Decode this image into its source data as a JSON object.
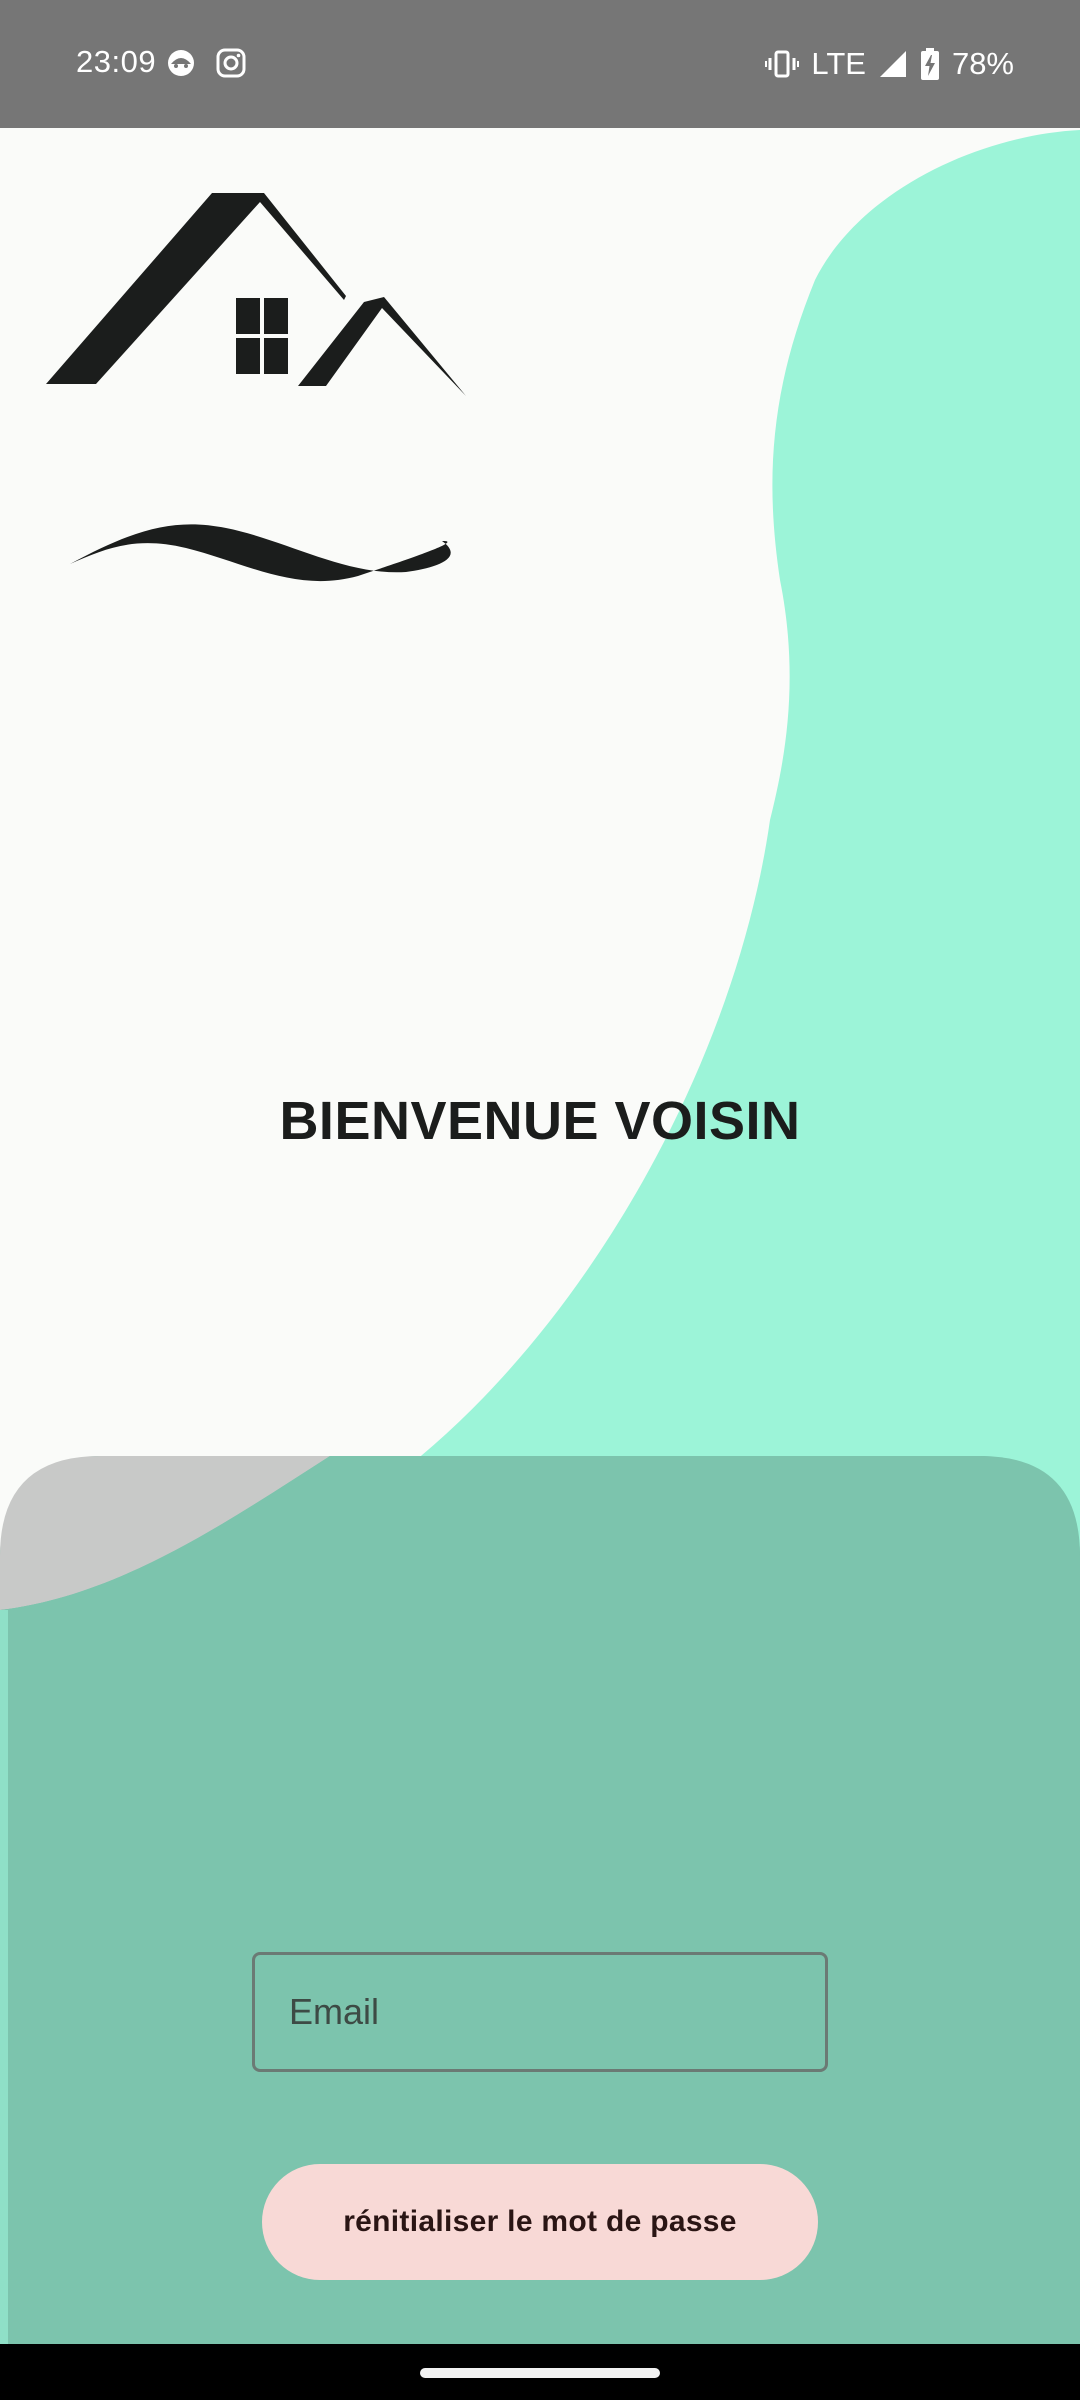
{
  "status_bar": {
    "time": "23:09",
    "network": "LTE",
    "battery": "78%",
    "icons_left": [
      "notification-face-icon",
      "instagram-icon"
    ],
    "icons_right": [
      "vibrate-icon",
      "signal-icon",
      "battery-charging-icon"
    ]
  },
  "logo": {
    "icon": "house-roofs-logo"
  },
  "welcome": {
    "title": "BIENVENUE VOISIN"
  },
  "form": {
    "email_placeholder": "Email",
    "email_value": "",
    "reset_button_label": "rénitialiser le mot de passe"
  },
  "colors": {
    "mint": "#9cf4d8",
    "card": "#60b297",
    "button": "#f8d9d6",
    "status_bar": "#767676",
    "background": "#fafbf9",
    "logo": "#1b1d1c"
  }
}
